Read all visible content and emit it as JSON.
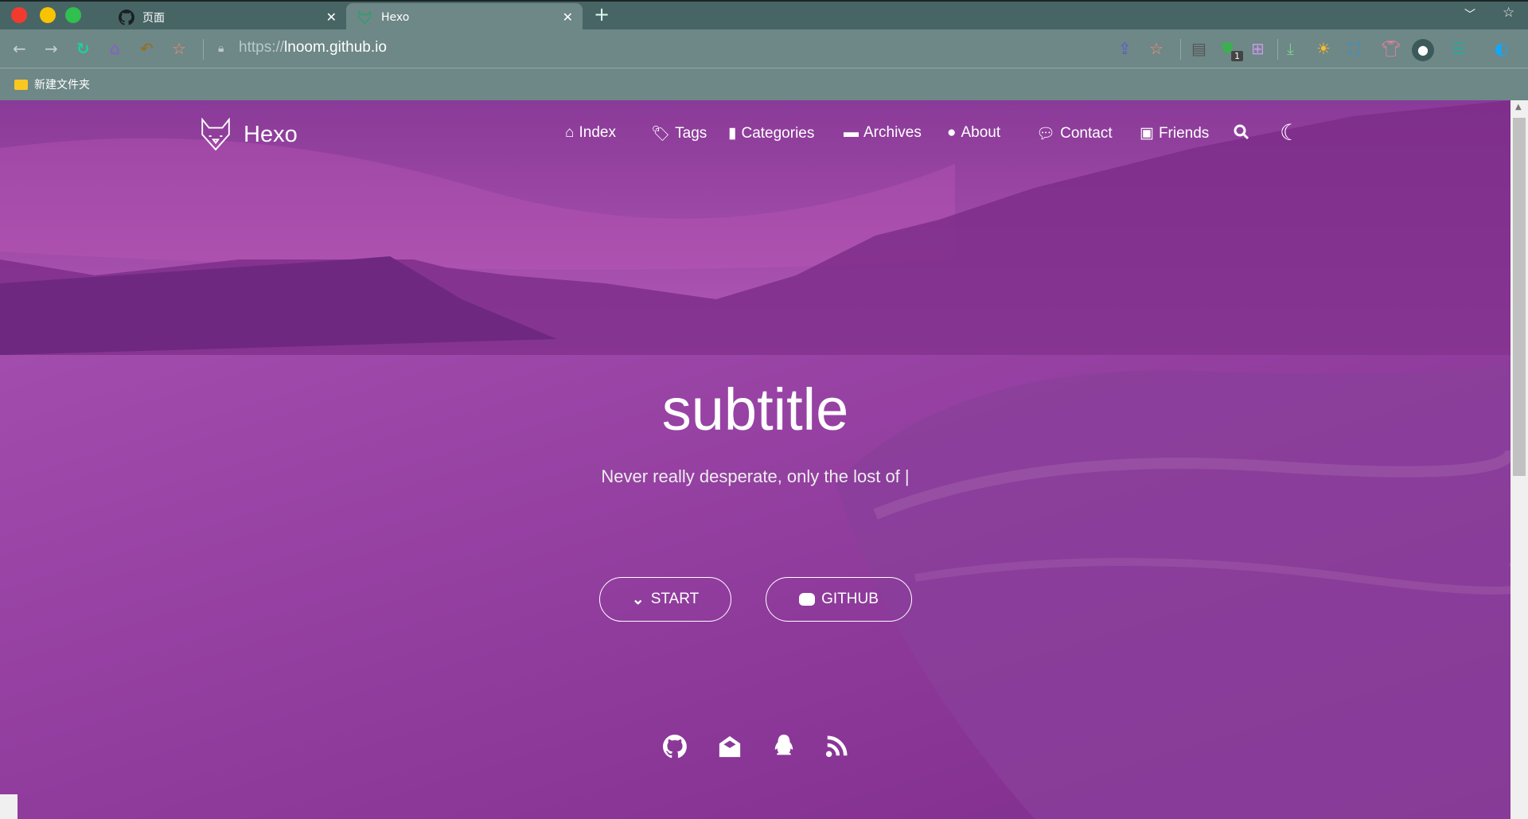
{
  "browser": {
    "tabs": [
      {
        "title": "页面",
        "icon": "github-icon",
        "active": false
      },
      {
        "title": "Hexo",
        "icon": "fox-icon",
        "active": true
      }
    ],
    "new_tab_label": "+",
    "address": {
      "scheme": "https://",
      "host": "lnoom.github.io"
    },
    "bookmarks": [
      {
        "label": "新建文件夹",
        "icon": "folder-icon"
      }
    ],
    "extension_badge": "1"
  },
  "site": {
    "logo_text": "Hexo",
    "nav": [
      {
        "label": "Index",
        "icon": "home-icon"
      },
      {
        "label": "Tags",
        "icon": "tags-icon"
      },
      {
        "label": "Categories",
        "icon": "bookmark-icon"
      },
      {
        "label": "Archives",
        "icon": "archive-icon"
      },
      {
        "label": "About",
        "icon": "user-circle-icon"
      },
      {
        "label": "Contact",
        "icon": "comments-icon"
      },
      {
        "label": "Friends",
        "icon": "address-book-icon"
      }
    ],
    "hero": {
      "title": "subtitle",
      "tagline": "Never really desperate, only the lost of |",
      "start_label": "START",
      "github_label": "GITHUB"
    },
    "social": [
      "github-icon",
      "envelope-open-icon",
      "qq-icon",
      "rss-icon"
    ]
  },
  "colors": {
    "accent": "#8e3c9e",
    "toolbar": "#6e8787",
    "tabbar": "#486566"
  }
}
